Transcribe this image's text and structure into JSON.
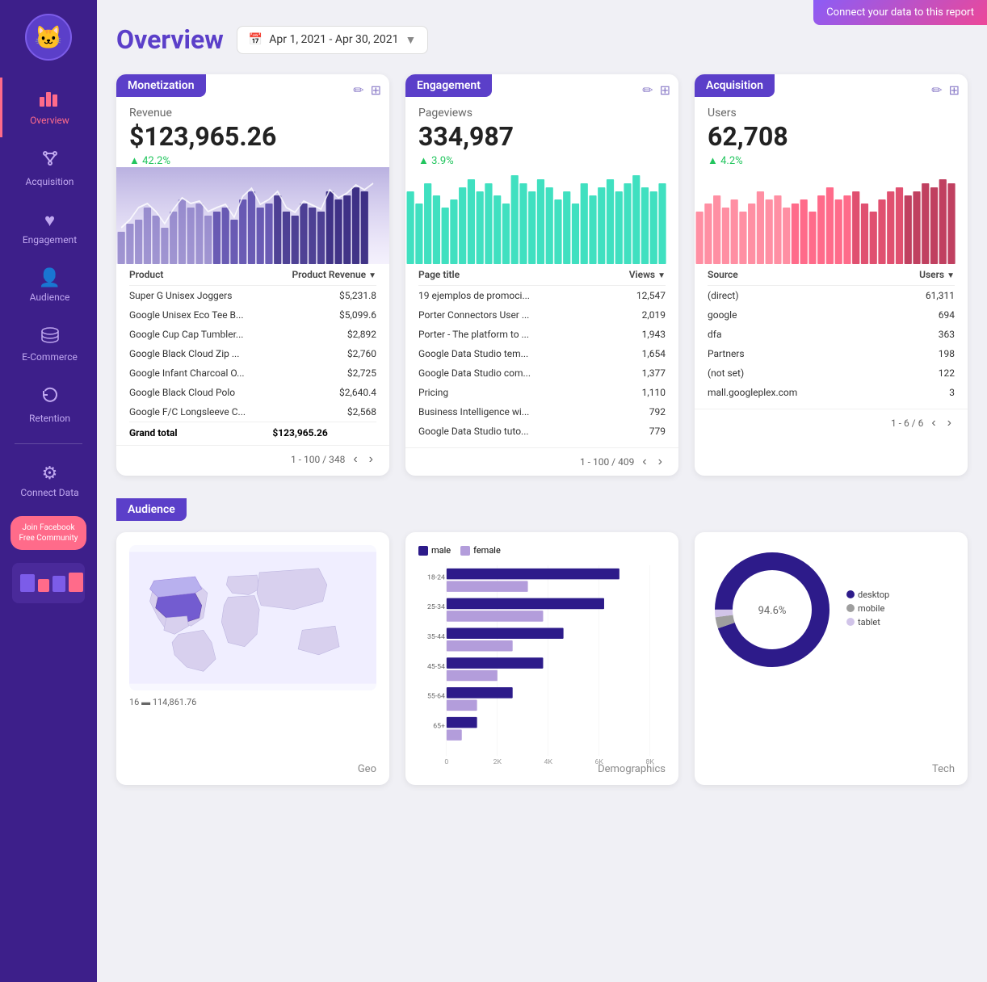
{
  "topBanner": {
    "label": "Connect your data to this report"
  },
  "sidebar": {
    "logo": "🐱",
    "items": [
      {
        "id": "overview",
        "label": "Overview",
        "icon": "📊",
        "active": true
      },
      {
        "id": "acquisition",
        "label": "Acquisition",
        "icon": "✦",
        "active": false
      },
      {
        "id": "engagement",
        "label": "Engagement",
        "icon": "♥",
        "active": false
      },
      {
        "id": "audience",
        "label": "Audience",
        "icon": "👤",
        "active": false
      },
      {
        "id": "ecommerce",
        "label": "E-Commerce",
        "icon": "🪙",
        "active": false
      },
      {
        "id": "retention",
        "label": "Retention",
        "icon": "🔄",
        "active": false
      }
    ],
    "connectData": {
      "icon": "⚙",
      "label": "Connect Data"
    },
    "joinBtn": "Join Facebook\nFree Community"
  },
  "header": {
    "title": "Overview",
    "datePicker": {
      "value": "Apr 1, 2021 - Apr 30, 2021",
      "icon": "📅"
    }
  },
  "monetization": {
    "badge": "Monetization",
    "metric": {
      "label": "Revenue",
      "value": "$123,965.26",
      "change": "42.2%"
    },
    "columns": {
      "col1": "Product",
      "col2": "Product Revenue",
      "sort": "▼"
    },
    "rows": [
      {
        "name": "Super G Unisex Joggers",
        "value": "$5,231.8"
      },
      {
        "name": "Google Unisex Eco Tee B...",
        "value": "$5,099.6"
      },
      {
        "name": "Google Cup Cap Tumbler...",
        "value": "$2,892"
      },
      {
        "name": "Google Black Cloud Zip ...",
        "value": "$2,760"
      },
      {
        "name": "Google Infant Charcoal O...",
        "value": "$2,725"
      },
      {
        "name": "Google Black Cloud Polo",
        "value": "$2,640.4"
      },
      {
        "name": "Google F/C Longsleeve C...",
        "value": "$2,568"
      }
    ],
    "grandTotal": {
      "label": "Grand total",
      "value": "$123,965.26"
    },
    "pagination": "1 - 100 / 348"
  },
  "engagement": {
    "badge": "Engagement",
    "metric": {
      "label": "Pageviews",
      "value": "334,987",
      "change": "3.9%"
    },
    "columns": {
      "col1": "Page title",
      "col2": "Views",
      "sort": "▼"
    },
    "rows": [
      {
        "name": "19 ejemplos de promoci...",
        "value": "12,547"
      },
      {
        "name": "Porter Connectors User ...",
        "value": "2,019"
      },
      {
        "name": "Porter - The platform to ...",
        "value": "1,943"
      },
      {
        "name": "Google Data Studio tem...",
        "value": "1,654"
      },
      {
        "name": "Google Data Studio com...",
        "value": "1,377"
      },
      {
        "name": "Pricing",
        "value": "1,110"
      },
      {
        "name": "Business Intelligence wi...",
        "value": "792"
      },
      {
        "name": "Google Data Studio tuto...",
        "value": "779"
      }
    ],
    "pagination": "1 - 100 / 409"
  },
  "acquisition": {
    "badge": "Acquisition",
    "metric": {
      "label": "Users",
      "value": "62,708",
      "change": "4.2%"
    },
    "columns": {
      "col1": "Source",
      "col2": "Users",
      "sort": "▼"
    },
    "rows": [
      {
        "name": "(direct)",
        "value": "61,311"
      },
      {
        "name": "google",
        "value": "694"
      },
      {
        "name": "dfa",
        "value": "363"
      },
      {
        "name": "Partners",
        "value": "198"
      },
      {
        "name": "(not set)",
        "value": "122"
      },
      {
        "name": "mall.googleplex.com",
        "value": "3"
      }
    ],
    "pagination": "1 - 6 / 6"
  },
  "audienceSection": {
    "badge": "Audience",
    "geo": {
      "label": "Geo",
      "footer": "16 ▬ 114,861.76"
    },
    "demographics": {
      "label": "Demographics",
      "legend": [
        {
          "color": "#2d1b8a",
          "label": "male"
        },
        {
          "color": "#b39ddb",
          "label": "female"
        }
      ],
      "groups": [
        "18-24",
        "25-34",
        "35-44",
        "45-54",
        "55-64",
        "65+"
      ],
      "male": [
        6800,
        6200,
        4600,
        3800,
        2600,
        1200
      ],
      "female": [
        3200,
        3800,
        2600,
        2000,
        1200,
        600
      ],
      "maxVal": 8000
    },
    "tech": {
      "label": "Tech",
      "donutPercent": 94.6,
      "legend": [
        {
          "color": "#2d1b8a",
          "label": "desktop"
        },
        {
          "color": "#9e9e9e",
          "label": "mobile"
        },
        {
          "color": "#d1c4e9",
          "label": "tablet"
        }
      ]
    }
  }
}
